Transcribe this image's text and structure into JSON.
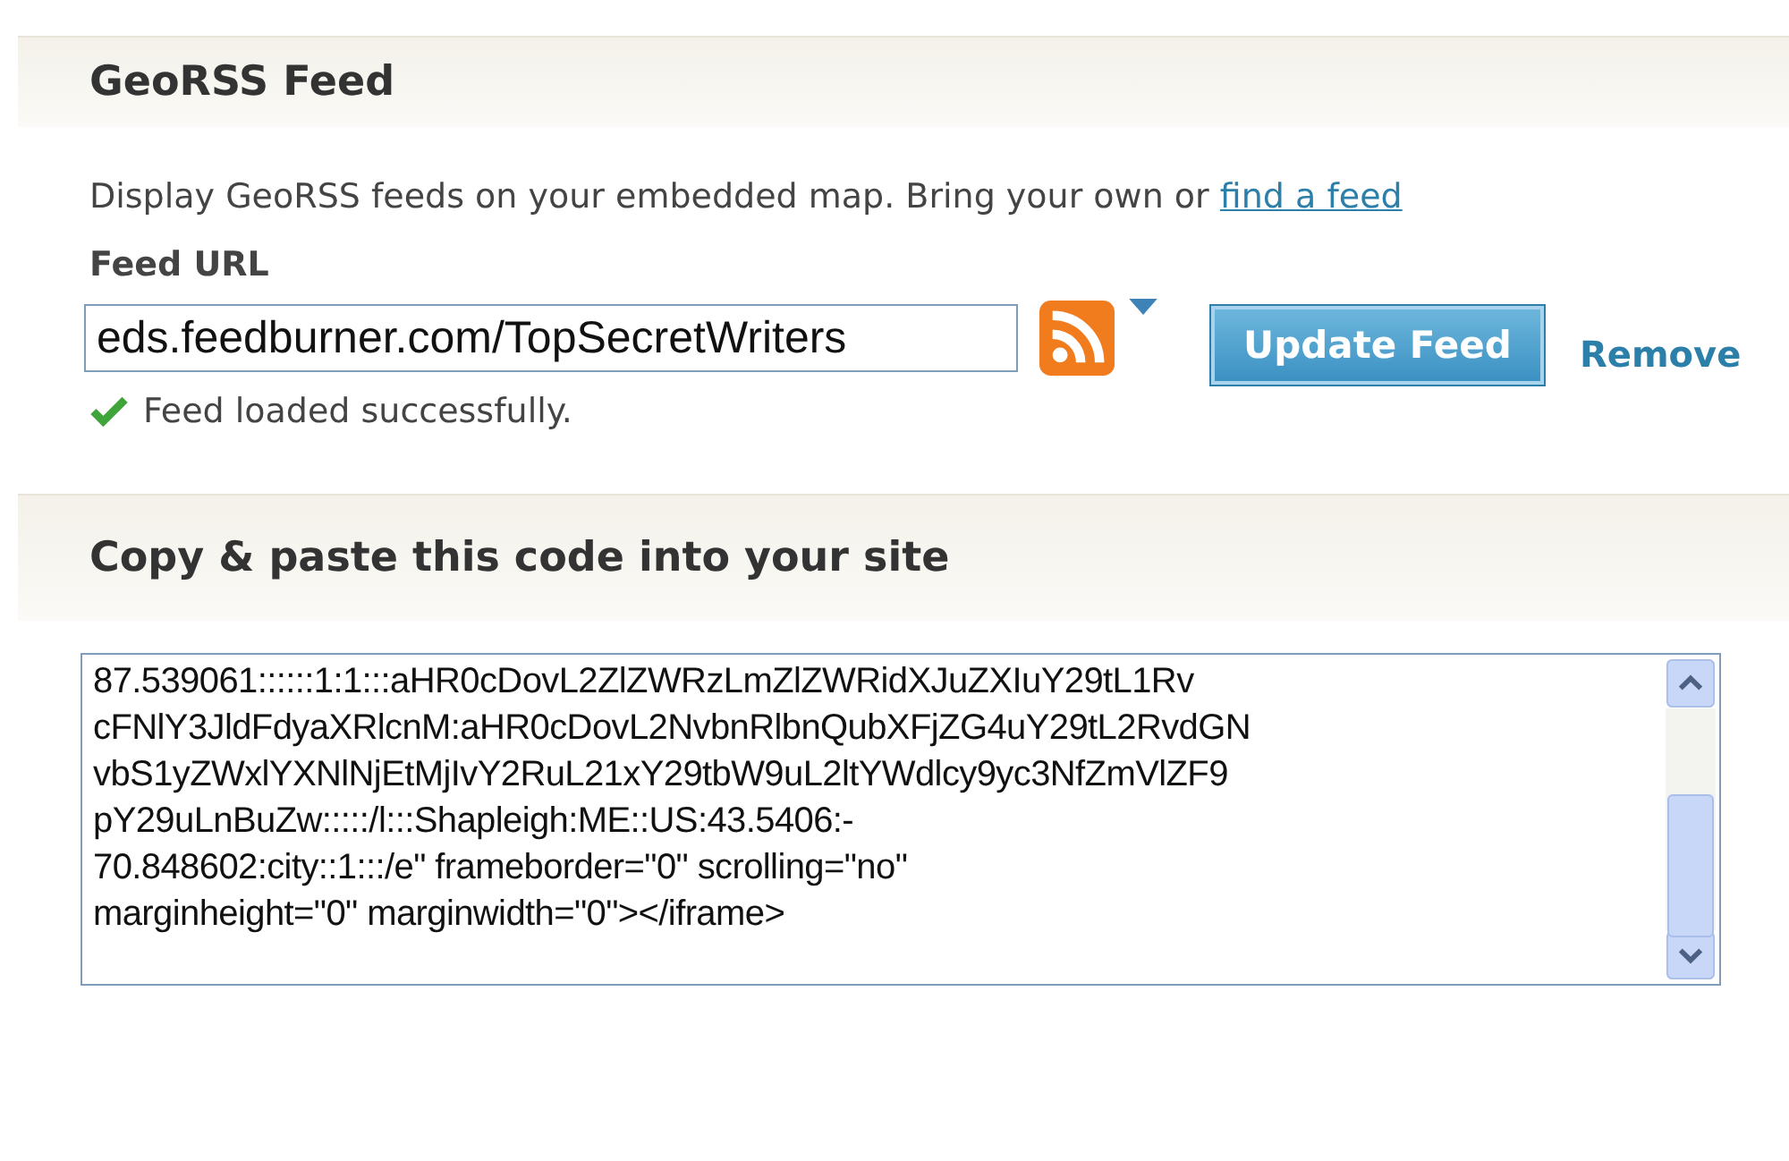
{
  "georss_section": {
    "title": "GeoRSS Feed",
    "description": "Display GeoRSS feeds on your embedded map. Bring your own or ",
    "link": "find a feed",
    "feed_url_label": "Feed URL",
    "feed_url_value": "eds.feedburner.com/TopSecretWriters",
    "update_button": "Update Feed",
    "remove_link": "Remove",
    "status": "Feed loaded successfully."
  },
  "code_section": {
    "title": "Copy & paste this code into your site",
    "code_lines": [
      "87.539061::::::1:1:::aHR0cDovL2ZlZWRzLmZlZWRidXJuZXIuY29tL1Rv",
      "cFNlY3JldFdyaXRlcnM:aHR0cDovL2NvbnRlbnQubXFjZG4uY29tL2RvdGN",
      "vbS1yZWxlYXNlNjEtMjIvY2RuL21xY29tbW9uL2ltYWdlcy9yc3NfZmVlZF9",
      "pY29uLnBuZw:::::/l:::Shapleigh:ME::US:43.5406:-",
      "70.848602:city::1:::/e\" frameborder=\"0\" scrolling=\"no\"",
      "marginheight=\"0\" marginwidth=\"0\"></iframe>"
    ]
  }
}
